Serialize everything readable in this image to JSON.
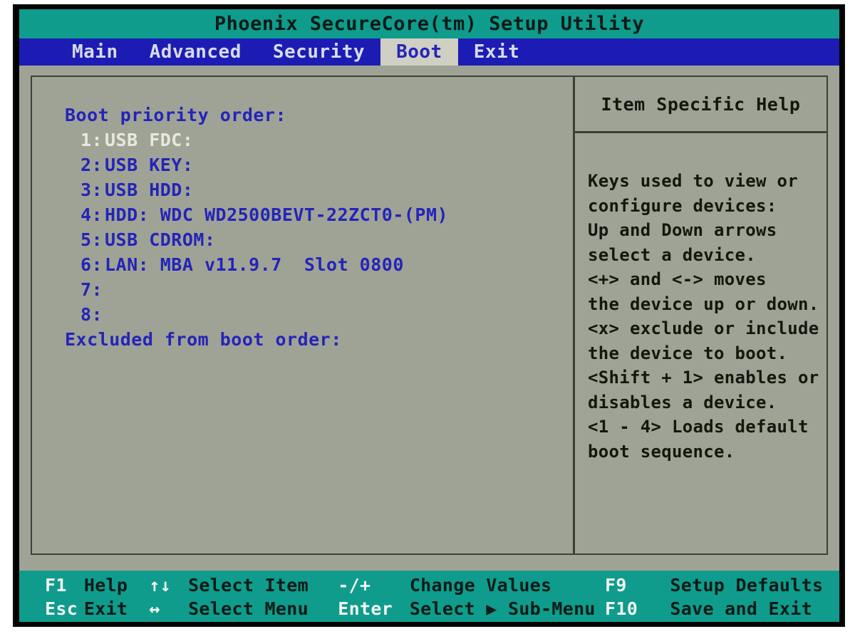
{
  "window": {
    "title": "Phoenix SecureCore(tm) Setup Utility"
  },
  "colors": {
    "title_bar": "#0f9c8c",
    "menu_bar": "#1c1cb4",
    "panel_bg": "#9fa396",
    "accent_text": "#2424b8",
    "selected_text": "#e8e8e0",
    "help_text": "#15170f",
    "key_bar": "#0f9c8c"
  },
  "menu": {
    "tabs": [
      {
        "label": "Main",
        "active": false
      },
      {
        "label": "Advanced",
        "active": false
      },
      {
        "label": "Security",
        "active": false
      },
      {
        "label": "Boot",
        "active": true
      },
      {
        "label": "Exit",
        "active": false
      }
    ]
  },
  "boot": {
    "priority_heading": "Boot priority order:",
    "items": [
      {
        "index": "1:",
        "label": "USB FDC:",
        "selected": true
      },
      {
        "index": "2:",
        "label": "USB KEY:",
        "selected": false
      },
      {
        "index": "3:",
        "label": "USB HDD:",
        "selected": false
      },
      {
        "index": "4:",
        "label": "HDD: WDC WD2500BEVT-22ZCT0-(PM)",
        "selected": false
      },
      {
        "index": "5:",
        "label": "USB CDROM:",
        "selected": false
      },
      {
        "index": "6:",
        "label": "LAN: MBA v11.9.7  Slot 0800",
        "selected": false
      },
      {
        "index": "7:",
        "label": "",
        "selected": false
      },
      {
        "index": "8:",
        "label": "",
        "selected": false
      }
    ],
    "excluded_heading": "Excluded from boot order:"
  },
  "help": {
    "header": "Item Specific Help",
    "lines": [
      "Keys used to view or",
      "configure devices:",
      "Up and Down arrows",
      "select a device.",
      "<+> and <-> moves",
      "the device up or down.",
      "<x> exclude or include",
      "the device to boot.",
      "<Shift + 1> enables or",
      "disables a device.",
      "<1 - 4> Loads default",
      "boot sequence."
    ]
  },
  "key_bar": {
    "row1": [
      {
        "key": "F1",
        "desc": "Help"
      },
      {
        "key": "↑↓",
        "desc": "Select Item"
      },
      {
        "key": "-/+",
        "desc": "Change Values"
      },
      {
        "key": "F9",
        "desc": "Setup Defaults"
      }
    ],
    "row2": [
      {
        "key": "Esc",
        "desc": "Exit"
      },
      {
        "key": "↔",
        "desc": "Select Menu"
      },
      {
        "key": "Enter",
        "desc": "Select ▶ Sub-Menu"
      },
      {
        "key": "F10",
        "desc": "Save and Exit"
      }
    ]
  }
}
